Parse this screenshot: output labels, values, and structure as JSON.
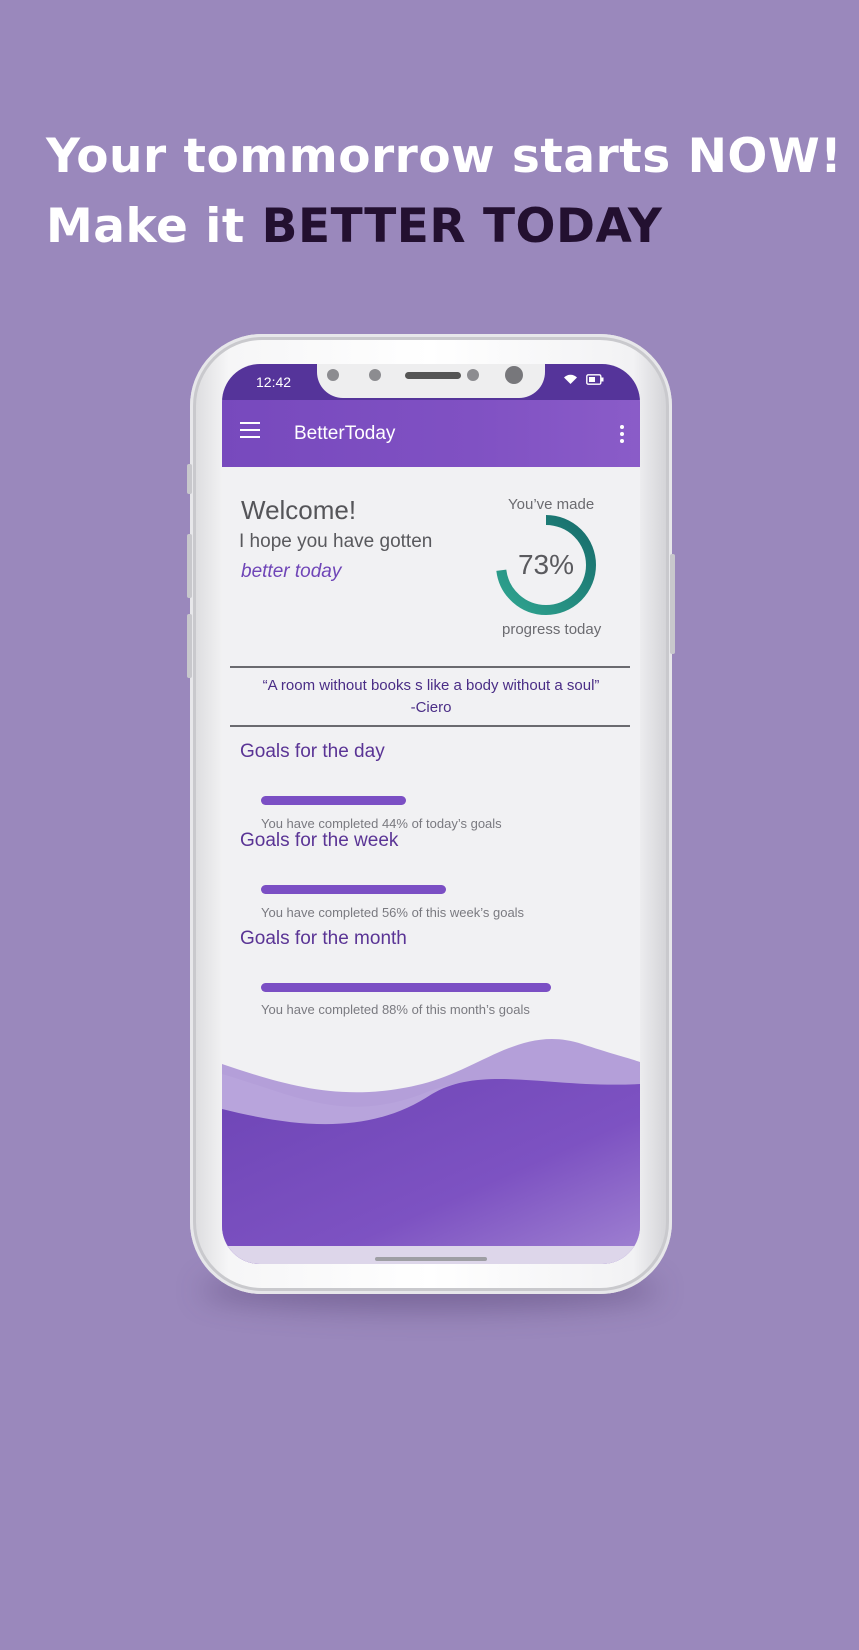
{
  "headline": {
    "line1": "Your tommorrow starts NOW!",
    "line2_prefix": "Make it ",
    "line2_emphasis": "BETTER TODAY"
  },
  "status_bar": {
    "time": "12:42",
    "icons": [
      "wifi-icon",
      "battery-icon"
    ]
  },
  "app_bar": {
    "title": "BetterToday",
    "menu_icon": "hamburger-menu-icon",
    "overflow_icon": "more-vert-icon"
  },
  "welcome": {
    "greeting": "Welcome!",
    "line2": "I hope you have gotten",
    "line3": "better today"
  },
  "progress": {
    "label_top": "You’ve made",
    "value_text": "73%",
    "value": 0.73,
    "label_bottom": "progress today"
  },
  "quote": {
    "text": "“A room without books s like a body without a soul”",
    "author": "-Ciero"
  },
  "goals": [
    {
      "title": "Goals for the day",
      "percent": 44,
      "text": "You have completed 44% of today’s goals"
    },
    {
      "title": "Goals for the week",
      "percent": 56,
      "text": "You have completed 56% of this week’s goals"
    },
    {
      "title": "Goals for the month",
      "percent": 88,
      "text": "You have completed 88% of this month’s goals"
    }
  ],
  "colors": {
    "background": "#9a88bc",
    "accent": "#7b4fc4",
    "ring": "#1f8a7e",
    "headline_dark": "#231030"
  }
}
